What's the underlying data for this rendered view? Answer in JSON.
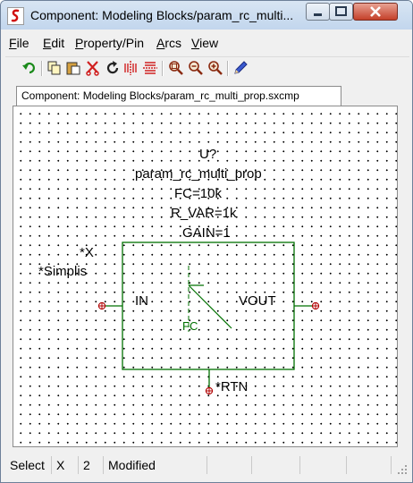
{
  "window": {
    "title": "Component: Modeling Blocks/param_rc_multi...",
    "app_icon": "simetrix-s-icon",
    "buttons": [
      "minimize-icon",
      "maximize-icon",
      "close-icon"
    ]
  },
  "menu": [
    {
      "key": "F",
      "rest": "ile"
    },
    {
      "key": "E",
      "rest": "dit"
    },
    {
      "key": "P",
      "rest": "roperty/Pin"
    },
    {
      "key": "A",
      "rest": "rcs"
    },
    {
      "key": "V",
      "rest": "iew"
    }
  ],
  "toolbar": {
    "icons": [
      "undo-icon",
      "copy-icon",
      "paste-icon",
      "cut-icon",
      "rotate-icon",
      "mirror-icon",
      "flip-icon",
      "zoom-fit-icon",
      "zoom-out-icon",
      "zoom-in-icon",
      "pencil-icon"
    ]
  },
  "tab": {
    "label": "Component: Modeling Blocks/param_rc_multi_prop.sxcmp"
  },
  "schematic": {
    "ref": "U?",
    "name": "param_rc_multi_prop",
    "param1": "FC=10k",
    "param2": "R_VAR=1k",
    "param3": "GAIN=1",
    "x_label": "*X",
    "simplis_label": "*Simplis",
    "pin_in": "IN",
    "pin_vout": "VOUT",
    "pin_rtn": "*RTN",
    "fc_label": "FC",
    "colors": {
      "body": "#007000",
      "pin": "#b00000",
      "text": "#000000"
    }
  },
  "status": {
    "mode": "Select",
    "axis": "X",
    "value": "2",
    "state": "Modified"
  }
}
